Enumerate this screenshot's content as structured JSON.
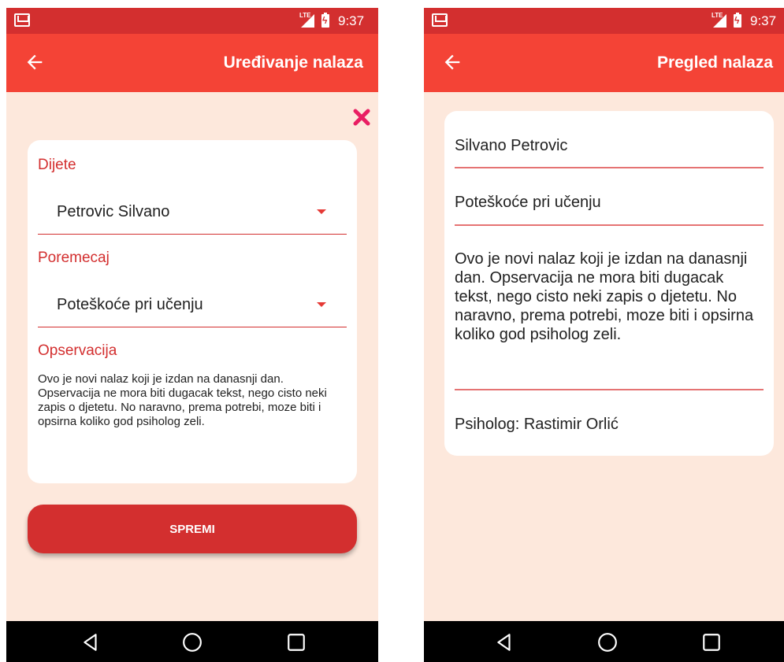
{
  "status_bar": {
    "time": "9:37",
    "network": "LTE"
  },
  "edit_screen": {
    "title": "Uređivanje nalaza",
    "child_label": "Dijete",
    "child_value": "Petrovic Silvano",
    "disorder_label": "Poremecaj",
    "disorder_value": "Poteškoće pri učenju",
    "observation_label": "Opservacija",
    "observation_text": "Ovo je novi nalaz koji je izdan na danasnji dan. Opservacija ne mora biti dugacak tekst, nego cisto neki zapis o djetetu. No naravno, prema potrebi, moze biti i opsirna koliko god psiholog zeli.",
    "save_label": "SPREMI"
  },
  "view_screen": {
    "title": "Pregled nalaza",
    "child_name": "Silvano Petrovic",
    "disorder": "Poteškoće pri učenju",
    "observation_text": "Ovo je novi nalaz koji je izdan na danasnji dan. Opservacija ne mora biti dugacak tekst, nego cisto neki zapis o djetetu. No naravno, prema potrebi, moze biti i opsirna koliko god psiholog zeli.",
    "psychologist": "Psiholog: Rastimir Orlić"
  },
  "icons": {
    "back": "arrow-left-icon",
    "close": "close-icon",
    "dropdown": "caret-down-icon",
    "nav_back": "triangle-back-icon",
    "nav_home": "circle-home-icon",
    "nav_recents": "square-recents-icon"
  },
  "colors": {
    "status_bar": "#d32f2f",
    "app_bar": "#f44336",
    "background": "#fde8dc",
    "accent": "#d32f2f",
    "close": "#e91e63",
    "nav_bar": "#000000"
  }
}
